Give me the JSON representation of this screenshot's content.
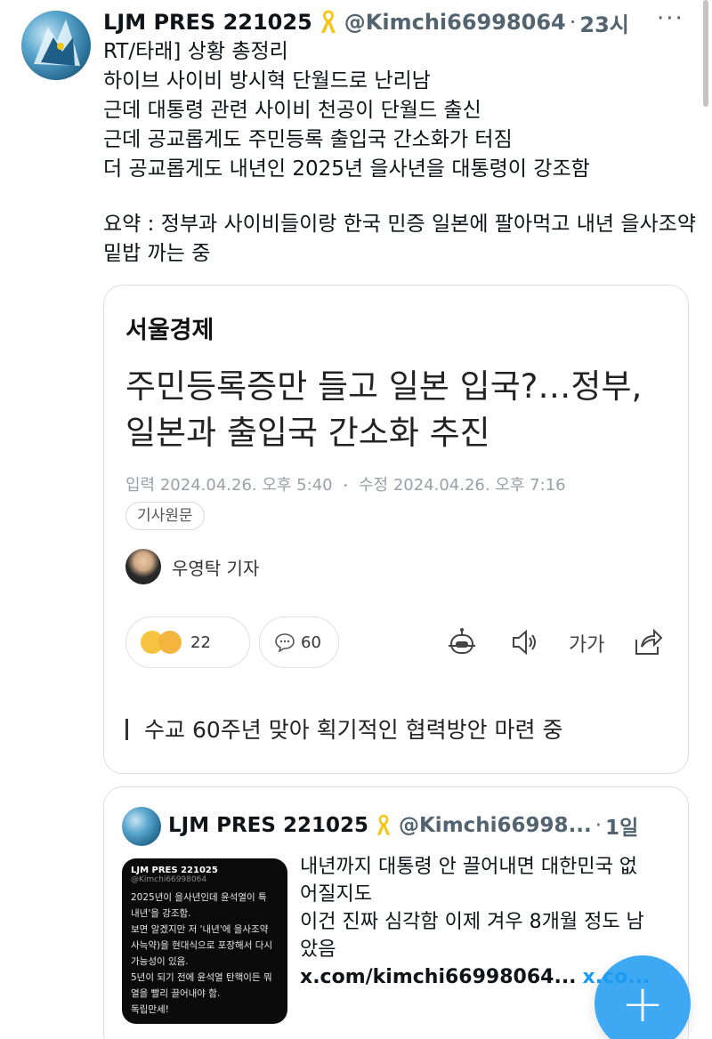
{
  "tweet": {
    "display_name": "LJM PRES 221025",
    "handle": "@Kimchi66998064",
    "separator": "·",
    "time": "23시",
    "more": "···",
    "lines": [
      "RT/타래] 상황 총정리",
      "하이브 사이비 방시혁 단월드로 난리남",
      "근데 대통령 관련 사이비 천공이 단월드 출신",
      "근데 공교롭게도 주민등록 출입국 간소화가 터짐",
      "더 공교롭게도 내년인 2025년 을사년을 대통령이 강조함"
    ],
    "summary": "요약 : 정부과 사이비들이랑 한국 민증 일본에 팔아먹고 내년 을사조약 밑밥 까는 중"
  },
  "article_card": {
    "press": "서울경제",
    "headline": "주민등록증만 들고 일본 입국?…정부, 일본과 출입국 간소화 추진",
    "input_date": "입력 2024.04.26. 오후 5:40",
    "edit_date": "수정 2024.04.26. 오후 7:16",
    "original_button": "기사원문",
    "reporter": "우영탁 기자",
    "reaction_count": "22",
    "comment_count": "60",
    "font_size_label": "가가",
    "subheadline": "수교 60주년 맞아 획기적인 협력방안 마련 중"
  },
  "quote_tweet": {
    "display_name": "LJM PRES 221025",
    "handle": "@Kimchi66998...",
    "separator": "·",
    "time": "1일",
    "thumb_name": "LJM PRES 221025",
    "thumb_handle": "@Kimchi66998064",
    "thumb_lines": [
      "2025년이 을사년인데 윤석열이 특",
      "내년'을 강조함.",
      "보면 알겠지만 저 '내년'에 을사조약",
      "사늑약)을 현대식으로 포장해서 다시",
      "가능성이 있음.",
      "5년이 되기 전에 윤석열 탄핵이든 뭐",
      "열을 빨리 끌어내야 함.",
      "독립만세!"
    ],
    "lines": [
      "내년까지 대통령 안 끌어내면 대한민국 없",
      "어질지도",
      "이건 진짜 심각함 이제 겨우 8개월 정도 남",
      "았음"
    ],
    "link": "x.com/kimchi66998064...",
    "link2": "x.co..."
  },
  "compose_button": "+",
  "colors": {
    "accent": "#1d9bf0",
    "ribbon": "#f5c518",
    "muted": "#536471"
  },
  "icons": [
    "ribbon-icon",
    "more-icon",
    "reaction-emoji-icon",
    "comment-icon",
    "robot-icon",
    "speaker-icon",
    "share-icon",
    "plus-icon"
  ]
}
